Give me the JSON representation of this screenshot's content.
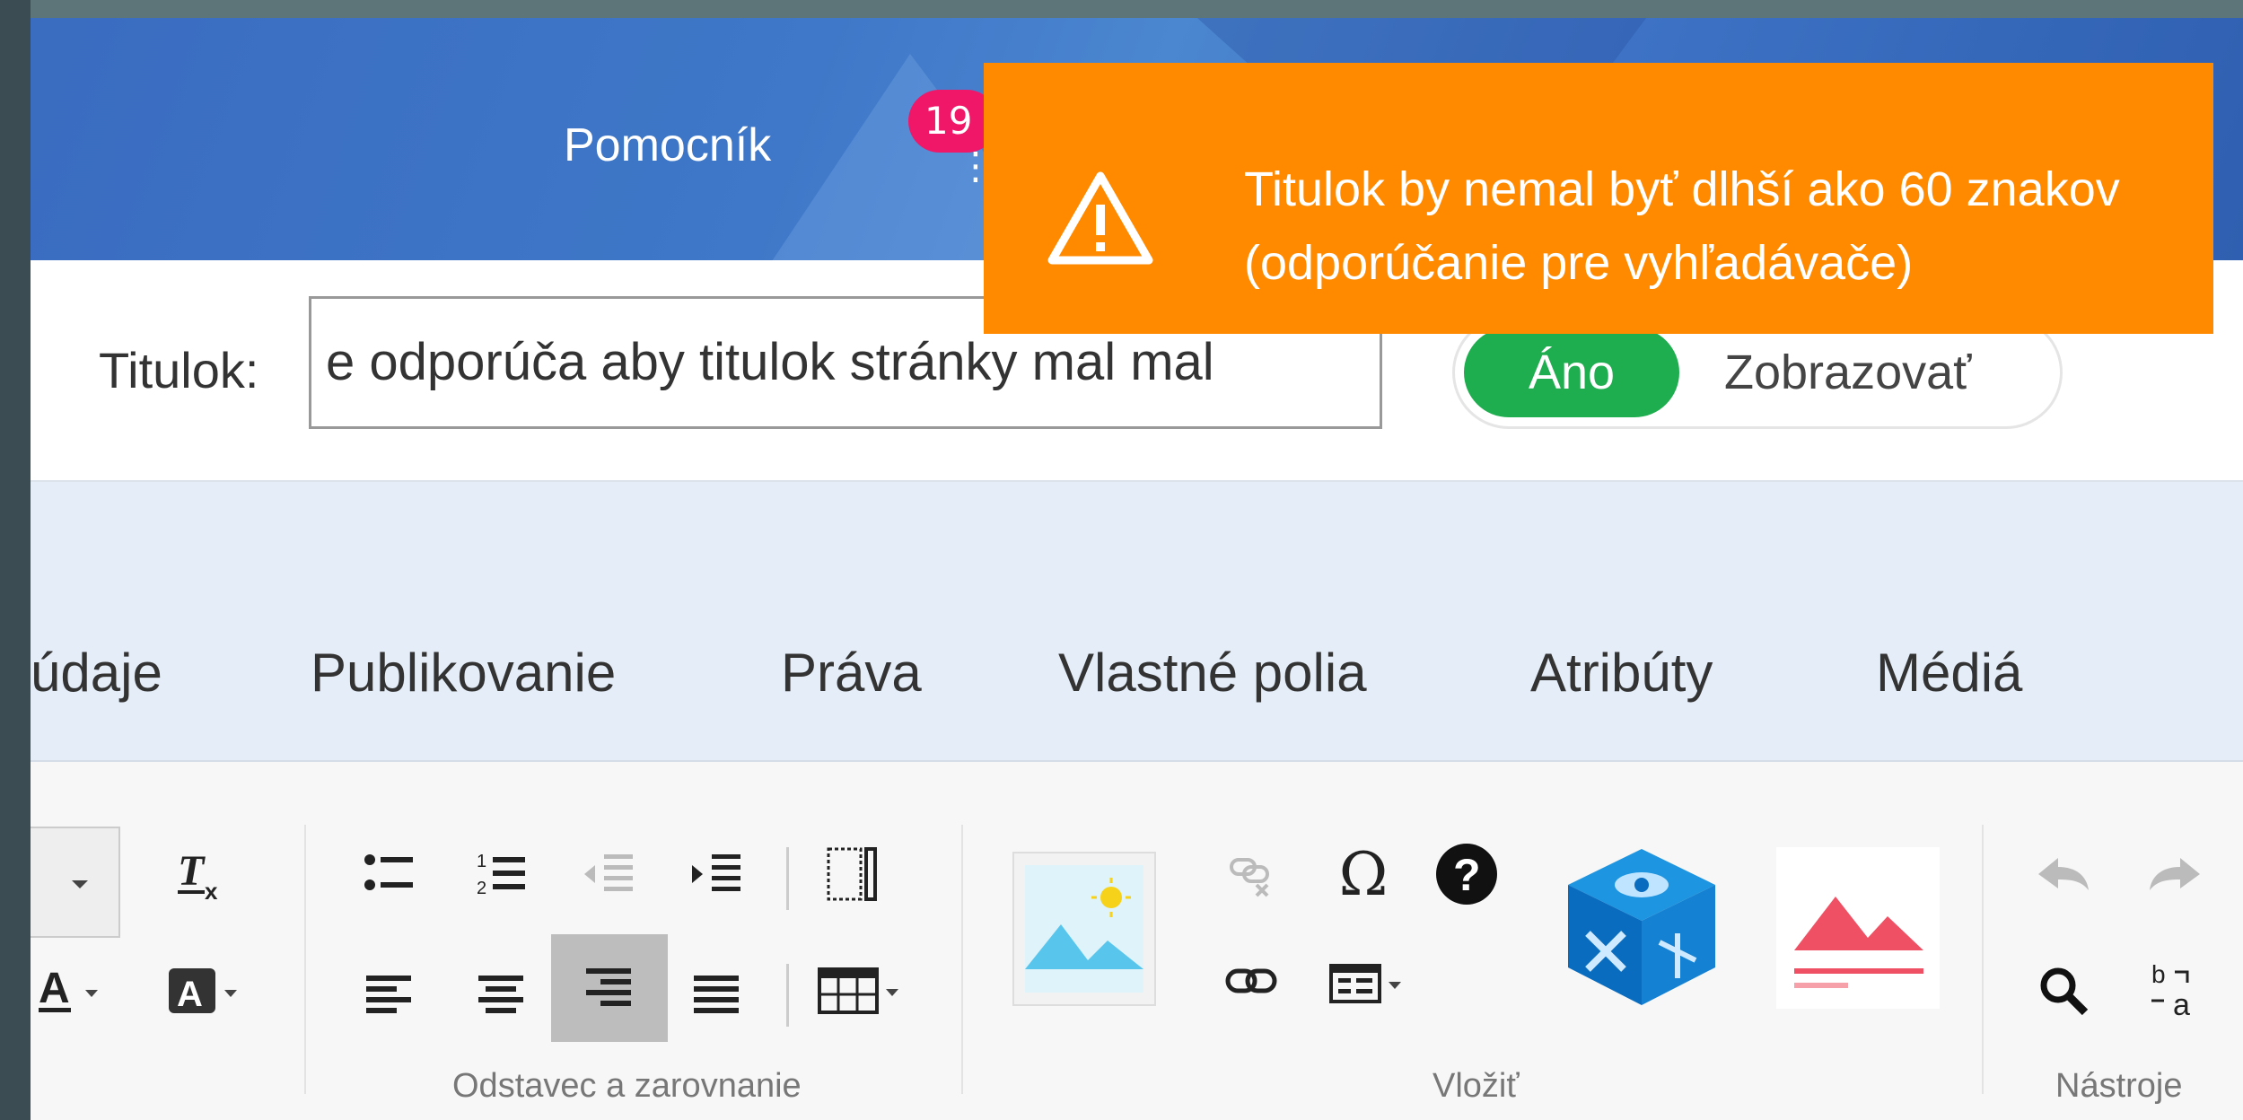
{
  "header": {
    "help_link": "Pomocník",
    "notification_count": "19",
    "more_glyph": "⋮"
  },
  "toast": {
    "icon": "warning-triangle-icon",
    "message": "Titulok by nemal byť dlhší ako 60 znakov (odporúčanie pre vyhľadávače)",
    "background": "#ff8a00"
  },
  "title_row": {
    "label": "Titulok:",
    "value": "e odporúča aby titulok stránky mal mal",
    "toggle_on_label": "Áno",
    "toggle_off_label": "Zobrazovať",
    "toggle_color": "#1fae4f"
  },
  "tabs": [
    "údaje",
    "Publikovanie",
    "Práva",
    "Vlastné polia",
    "Atribúty",
    "Médiá"
  ],
  "toolbar": {
    "groups": [
      "Odstavec a zarovnanie",
      "Vložiť",
      "Nástroje"
    ],
    "active_button": "align-right-button"
  }
}
